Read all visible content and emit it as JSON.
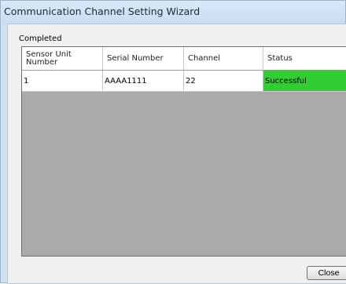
{
  "window": {
    "title": "Communication Channel Setting Wizard"
  },
  "status_label": "Completed",
  "table": {
    "headers": [
      "Sensor Unit Number",
      "Serial Number",
      "Channel",
      "Status"
    ],
    "rows": [
      [
        "1",
        "AAAA1111",
        "22",
        "Successful"
      ]
    ]
  },
  "buttons": {
    "close": "Close"
  },
  "colors": {
    "success": "#33cc33",
    "grid_background": "#aaaaaa"
  }
}
